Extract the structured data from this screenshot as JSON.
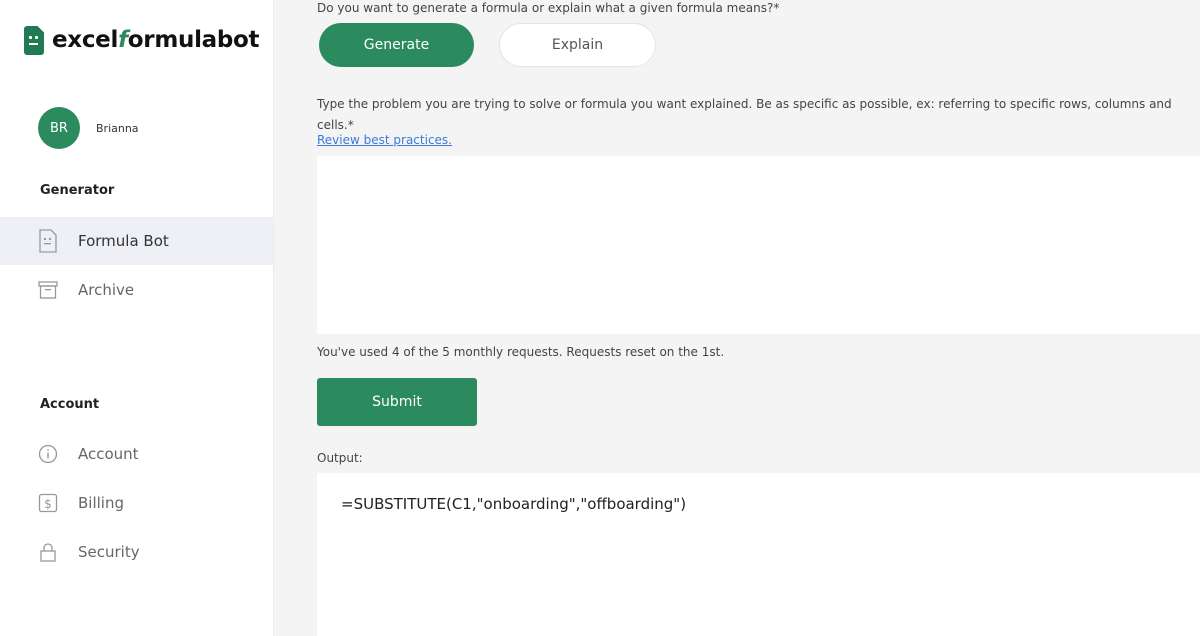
{
  "app": {
    "logo_prefix": "excel",
    "logo_accent": "f",
    "logo_suffix": "ormulabot",
    "brand_color": "#2b8a5e"
  },
  "user": {
    "initials": "BR",
    "name": "Brianna"
  },
  "sidebar": {
    "generator_label": "Generator",
    "account_section_label": "Account",
    "items": [
      {
        "label": "Formula Bot",
        "icon": "formula-bot-icon",
        "active": true
      },
      {
        "label": "Archive",
        "icon": "archive-icon",
        "active": false
      },
      {
        "label": "Account",
        "icon": "info-icon",
        "active": false
      },
      {
        "label": "Billing",
        "icon": "dollar-icon",
        "active": false
      },
      {
        "label": "Security",
        "icon": "lock-icon",
        "active": false
      }
    ]
  },
  "main": {
    "mode_question": "Do you want to generate a formula or explain what a given formula means?*",
    "generate_label": "Generate",
    "explain_label": "Explain",
    "problem_label": "Type the problem you are trying to solve or formula you want explained. Be as specific as possible, ex: referring to specific rows, columns and cells.*",
    "review_link": "Review best practices.",
    "problem_value": "",
    "usage_text": "You've used 4 of the 5 monthly requests. Requests reset on the 1st.",
    "submit_label": "Submit",
    "output_label": "Output:",
    "output_value": "=SUBSTITUTE(C1,\"onboarding\",\"offboarding\")"
  }
}
